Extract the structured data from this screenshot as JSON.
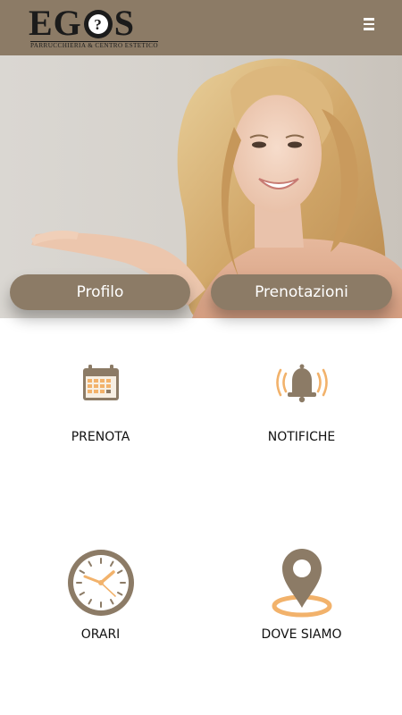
{
  "header": {
    "logo_word": "EG?S",
    "logo_tagline": "PARRUCCHIERIA & CENTRO ESTETICO",
    "menu_icon": "hamburger-menu-icon"
  },
  "hero": {
    "image_subject": "smiling blonde woman presenting with open hand",
    "buttons": {
      "profile_label": "Profilo",
      "bookings_label": "Prenotazioni"
    }
  },
  "tiles": [
    {
      "label": "PRENOTA",
      "icon": "calendar-icon"
    },
    {
      "label": "NOTIFICHE",
      "icon": "ringing-bell-icon"
    },
    {
      "label": "ORARI",
      "icon": "clock-icon"
    },
    {
      "label": "DOVE SIAMO",
      "icon": "map-pin-icon"
    }
  ],
  "colors": {
    "brand": "#8c7b66",
    "accent": "#f2b26b",
    "text": "#111111",
    "background": "#ffffff"
  }
}
